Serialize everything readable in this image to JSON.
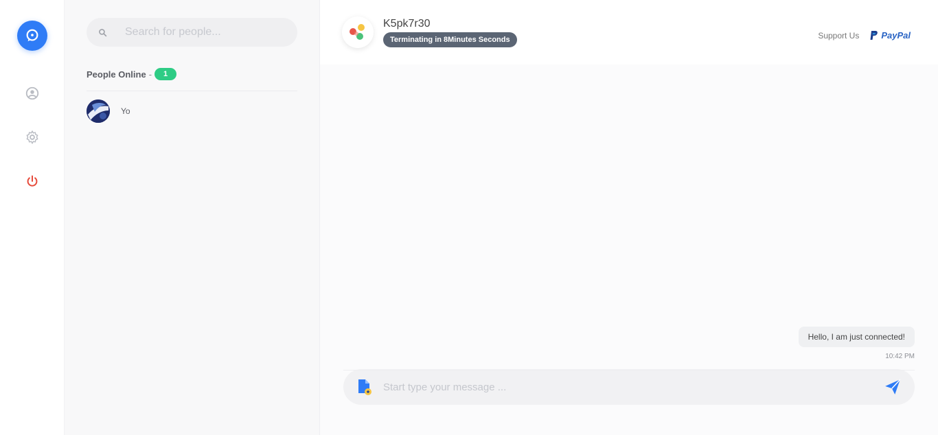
{
  "sidebar": {
    "logo_icon": "chat-bubble-icon",
    "nav": [
      {
        "name": "profile-icon"
      },
      {
        "name": "gear-icon"
      },
      {
        "name": "power-icon"
      }
    ],
    "colors": {
      "accent": "#2f7cf6",
      "logout": "#e74c3c",
      "muted": "#b9bcc3"
    }
  },
  "people": {
    "search_placeholder": "Search for people...",
    "online_title": "People Online",
    "online_separator": "-",
    "online_count": "1",
    "list": [
      {
        "name": "Yo"
      }
    ]
  },
  "chat": {
    "title": "K5pk7r30",
    "badge": "Terminating in 8Minutes Seconds",
    "support_label": "Support Us",
    "paypal_label": "PayPal",
    "messages": [
      {
        "text": "Hello, I am just connected!",
        "time": "10:42 PM"
      }
    ],
    "composer_placeholder": "Start type your message ..."
  },
  "colors": {
    "online": "#2ecc85",
    "badge": "#5b6574",
    "paypal": "#2a64c4",
    "send": "#2f7cf6"
  }
}
